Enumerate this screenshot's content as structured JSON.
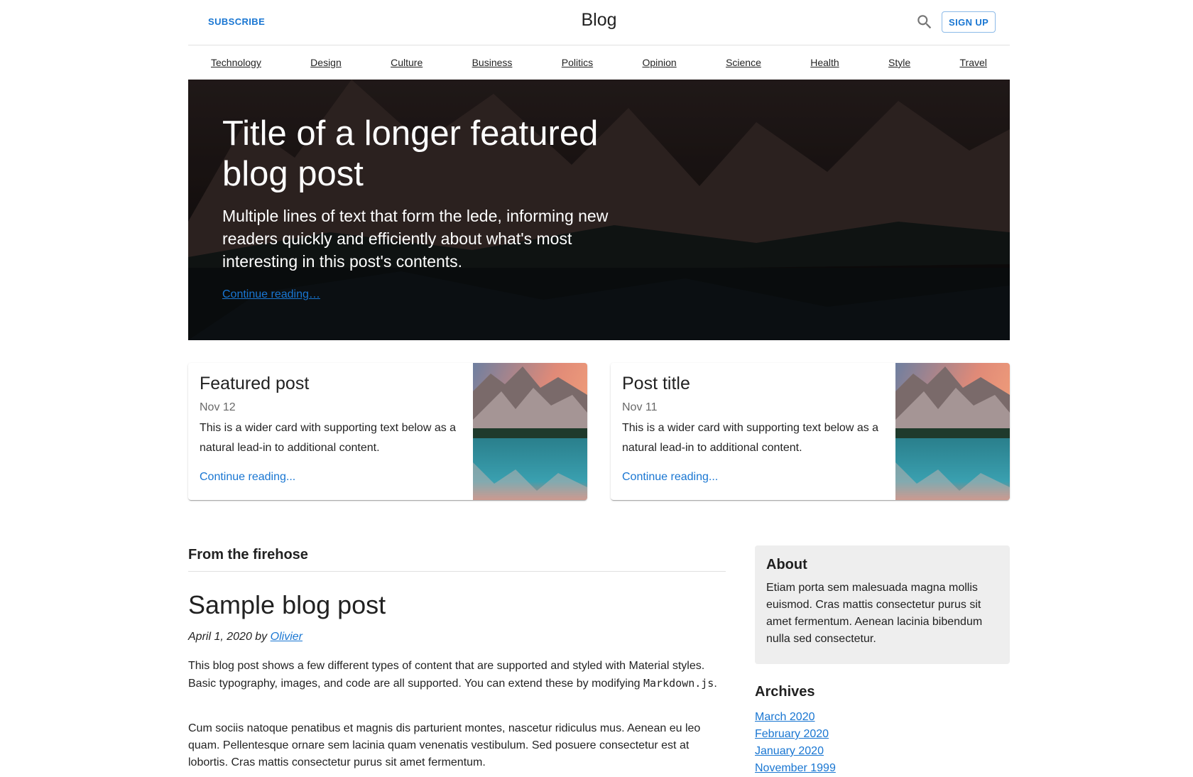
{
  "header": {
    "subscribe": "SUBSCRIBE",
    "title": "Blog",
    "search_icon": "search-icon",
    "signup": "SIGN UP"
  },
  "nav": [
    "Technology",
    "Design",
    "Culture",
    "Business",
    "Politics",
    "Opinion",
    "Science",
    "Health",
    "Style",
    "Travel"
  ],
  "hero": {
    "title": "Title of a longer featured blog post",
    "lede": "Multiple lines of text that form the lede, informing new readers quickly and efficiently about what's most interesting in this post's contents.",
    "link": "Continue reading…"
  },
  "cards": [
    {
      "title": "Featured post",
      "date": "Nov 12",
      "description": "This is a wider card with supporting text below as a natural lead-in to additional content.",
      "link": "Continue reading..."
    },
    {
      "title": "Post title",
      "date": "Nov 11",
      "description": "This is a wider card with supporting text below as a natural lead-in to additional content.",
      "link": "Continue reading..."
    }
  ],
  "main": {
    "section_title": "From the firehose",
    "post": {
      "title": "Sample blog post",
      "date": "April 1, 2020 by",
      "author": "Olivier",
      "p1_text": "This blog post shows a few different types of content that are supported and styled with Material styles. Basic typography, images, and code are all supported. You can extend these by modifying ",
      "p1_code": "Markdown.js",
      "p1_end": ".",
      "p2": "Cum sociis natoque penatibus et magnis dis parturient montes, nascetur ridiculus mus. Aenean eu leo quam. Pellentesque ornare sem lacinia quam venenatis vestibulum. Sed posuere consectetur est at lobortis. Cras mattis consectetur purus sit amet fermentum."
    }
  },
  "sidebar": {
    "about_title": "About",
    "about_text": "Etiam porta sem malesuada magna mollis euismod. Cras mattis consectetur purus sit amet fermentum. Aenean lacinia bibendum nulla sed consectetur.",
    "archives_title": "Archives",
    "archives": [
      "March 2020",
      "February 2020",
      "January 2020",
      "November 1999"
    ]
  },
  "colors": {
    "primary": "#1976d2",
    "about_bg": "#eeeeee"
  }
}
